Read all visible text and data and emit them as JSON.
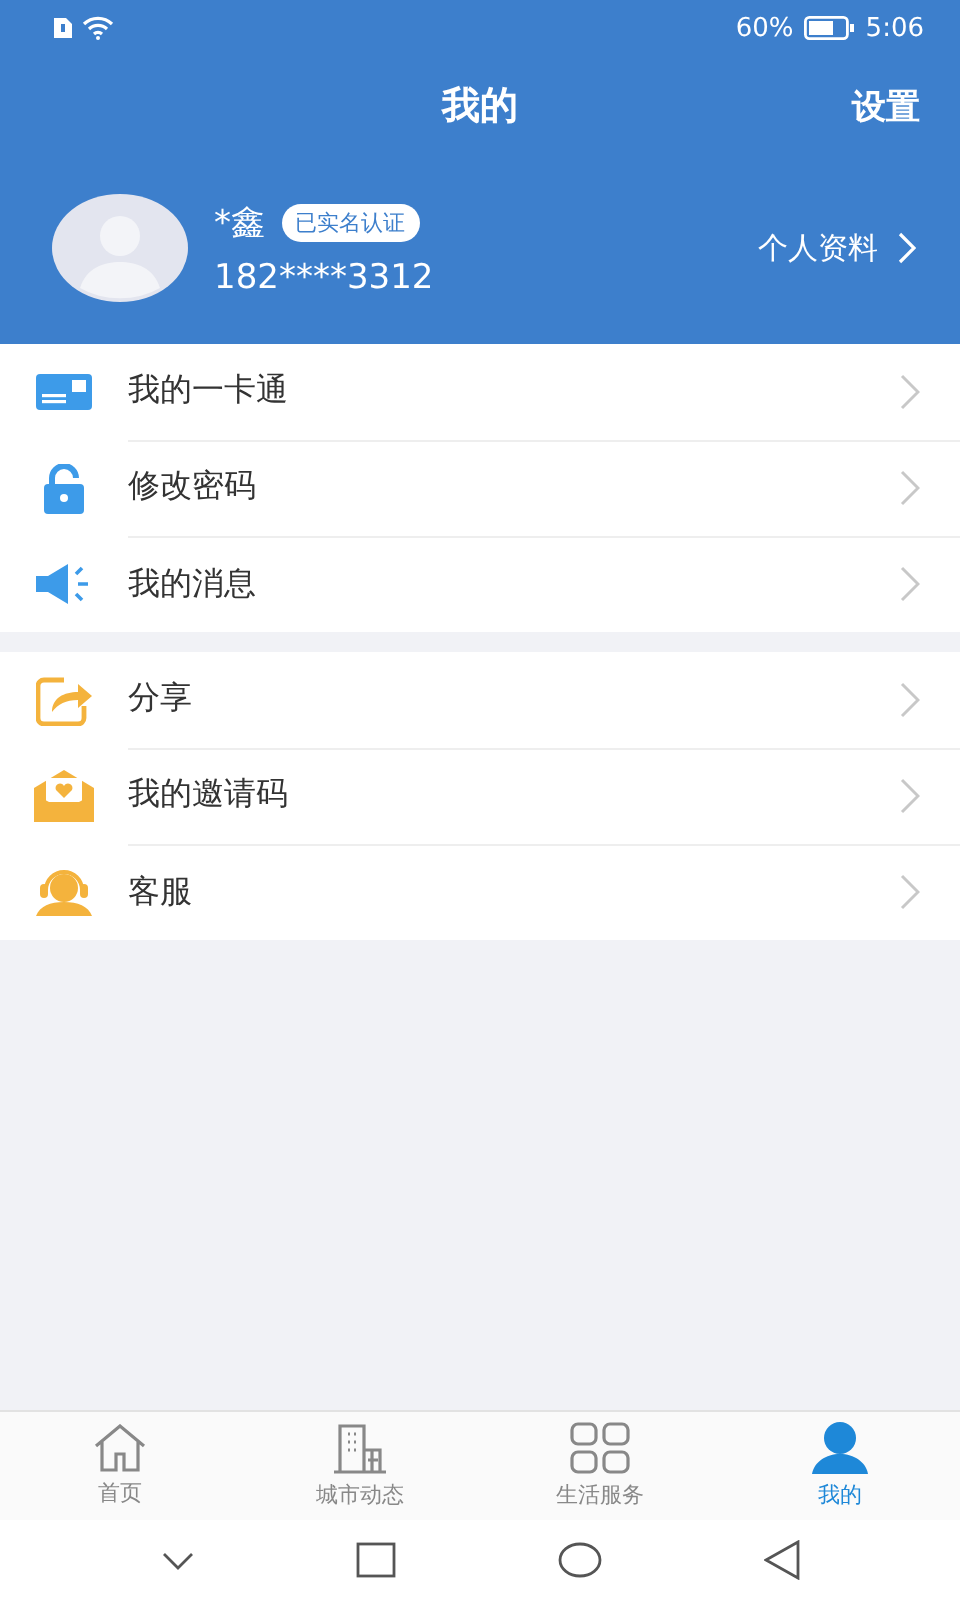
{
  "status_bar": {
    "battery": "60%",
    "time": "5:06"
  },
  "header": {
    "title": "我的",
    "settings": "设置"
  },
  "profile": {
    "name": "*鑫",
    "verified_badge": "已实名认证",
    "phone": "182****3312",
    "profile_link": "个人资料"
  },
  "menu_groups": [
    [
      {
        "kind": "card",
        "label": "我的一卡通"
      },
      {
        "kind": "lock",
        "label": "修改密码"
      },
      {
        "kind": "speaker",
        "label": "我的消息"
      }
    ],
    [
      {
        "kind": "share",
        "label": "分享"
      },
      {
        "kind": "envelope",
        "label": "我的邀请码"
      },
      {
        "kind": "headset",
        "label": "客服"
      }
    ]
  ],
  "tab_bar": [
    {
      "kind": "home",
      "label": "首页",
      "selected": false
    },
    {
      "kind": "building",
      "label": "城市动态",
      "selected": false
    },
    {
      "kind": "grid",
      "label": "生活服务",
      "selected": false
    },
    {
      "kind": "person",
      "label": "我的",
      "selected": true
    }
  ]
}
